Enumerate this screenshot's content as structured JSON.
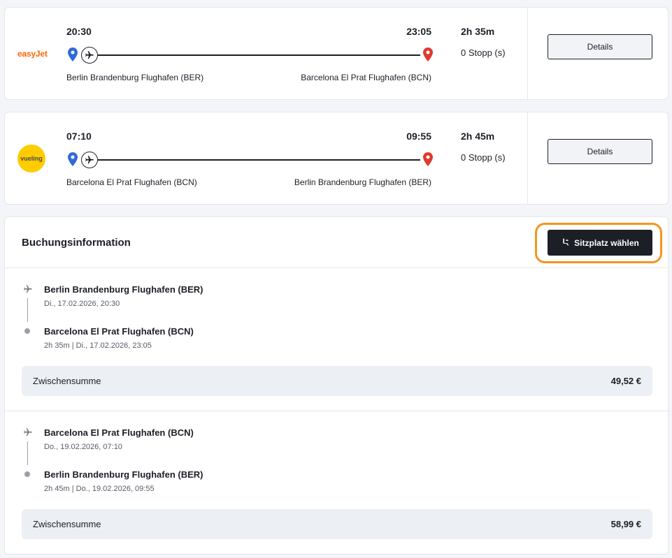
{
  "flights": [
    {
      "airline_logo_text": "easyJet",
      "departure_time": "20:30",
      "arrival_time": "23:05",
      "departure_airport": "Berlin Brandenburg Flughafen (BER)",
      "arrival_airport": "Barcelona El Prat Flughafen (BCN)",
      "duration": "2h 35m",
      "stops": "0 Stopp (s)",
      "details_label": "Details"
    },
    {
      "airline_logo_text": "vueling",
      "departure_time": "07:10",
      "arrival_time": "09:55",
      "departure_airport": "Barcelona El Prat Flughafen (BCN)",
      "arrival_airport": "Berlin Brandenburg Flughafen (BER)",
      "duration": "2h 45m",
      "stops": "0 Stopp (s)",
      "details_label": "Details"
    }
  ],
  "booking": {
    "title": "Buchungsinformation",
    "seat_button_label": "Sitzplatz wählen",
    "segments": [
      {
        "from_airport": "Berlin Brandenburg Flughafen (BER)",
        "from_datetime": "Di., 17.02.2026, 20:30",
        "to_airport": "Barcelona El Prat Flughafen (BCN)",
        "to_info": "2h 35m | Di., 17.02.2026, 23:05",
        "subtotal_label": "Zwischensumme",
        "subtotal_value": "49,52 €"
      },
      {
        "from_airport": "Barcelona El Prat Flughafen (BCN)",
        "from_datetime": "Do., 19.02.2026, 07:10",
        "to_airport": "Berlin Brandenburg Flughafen (BER)",
        "to_info": "2h 45m | Do., 19.02.2026, 09:55",
        "subtotal_label": "Zwischensumme",
        "subtotal_value": "58,99 €"
      }
    ]
  },
  "colors": {
    "accent_dark": "#1c1f26",
    "highlight_orange": "#f7941d",
    "pin_blue": "#2f6bd8",
    "pin_red": "#e03a2f",
    "easyjet_orange": "#ff6600",
    "vueling_yellow": "#ffcc00"
  },
  "icons": {
    "departure_pin": "map-pin-icon",
    "arrival_pin": "map-pin-icon",
    "plane": "airplane-icon",
    "seat": "seat-icon"
  }
}
